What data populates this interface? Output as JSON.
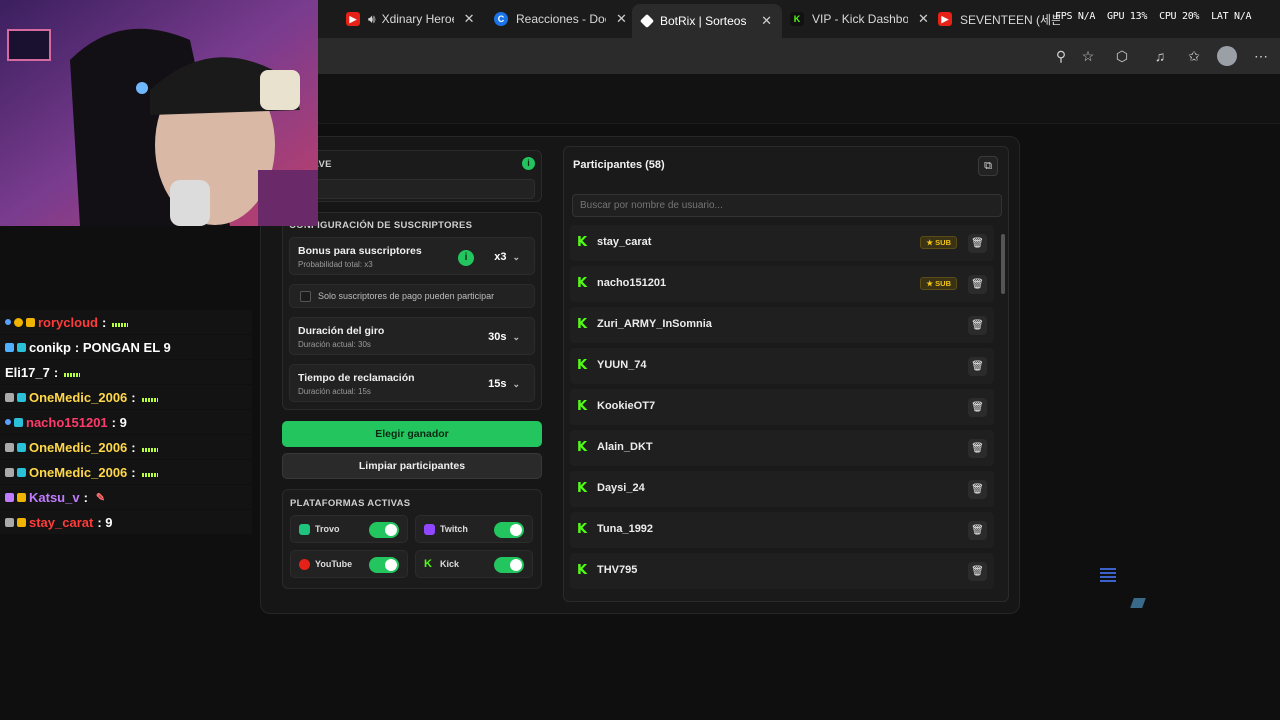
{
  "browser": {
    "tabs": [
      {
        "label": "Xdinary Heroes",
        "icon": "youtube-icon",
        "audio": true
      },
      {
        "label": "Reacciones - Doc",
        "icon": "c-icon"
      },
      {
        "label": "BotRix | Sorteos",
        "icon": "botrix-icon",
        "active": true
      },
      {
        "label": "VIP - Kick Dashboa",
        "icon": "kick-icon"
      },
      {
        "label": "SEVENTEEN (세븐틴)",
        "icon": "youtube-icon"
      }
    ],
    "perf": {
      "fps": "FPS N/A",
      "gpu": "GPU 13%",
      "cpu": "CPU 20%",
      "lat": "LAT N/A"
    }
  },
  "giveaway": {
    "keyword_title": "A CLAVE",
    "sub_config_title": "CONFIGURACIÓN DE SUSCRIPTORES",
    "bonus": {
      "title": "Bonus para suscriptores",
      "subtitle": "Probabilidad total: x3",
      "value": "x3"
    },
    "only_paid": "Solo suscriptores de pago pueden participar",
    "spin": {
      "title": "Duración del giro",
      "subtitle": "Duración actual: 30s",
      "value": "30s"
    },
    "claim": {
      "title": "Tiempo de reclamación",
      "subtitle": "Duración actual: 15s",
      "value": "15s"
    },
    "pick_winner": "Elegir ganador",
    "clear": "Limpiar participantes",
    "platforms_title": "PLATAFORMAS ACTIVAS",
    "platforms": [
      {
        "name": "Trovo",
        "color": "#1ec47e",
        "on": true
      },
      {
        "name": "Twitch",
        "color": "#9146ff",
        "on": true
      },
      {
        "name": "YouTube",
        "color": "#e62117",
        "on": true
      },
      {
        "name": "Kick",
        "color": "#53fc18",
        "on": true
      }
    ]
  },
  "participants": {
    "title": "Participantes (58)",
    "search_placeholder": "Buscar por nombre de usuario...",
    "sub_label": "SUB",
    "items": [
      {
        "name": "stay_carat",
        "sub": true
      },
      {
        "name": "nacho151201",
        "sub": true
      },
      {
        "name": "Zuri_ARMY_InSomnia",
        "sub": false
      },
      {
        "name": "YUUN_74",
        "sub": false
      },
      {
        "name": "KookieOT7",
        "sub": false
      },
      {
        "name": "Alain_DKT",
        "sub": false
      },
      {
        "name": "Daysi_24",
        "sub": false
      },
      {
        "name": "Tuna_1992",
        "sub": false
      },
      {
        "name": "THV795",
        "sub": false
      }
    ]
  },
  "chat": [
    {
      "user": "rorycloud",
      "color": "#ff3b3b",
      "msg": ":",
      "emote": true
    },
    {
      "user": "conikp",
      "color": "#ffffff",
      "msg": ": PONGAN EL 9",
      "emote": false
    },
    {
      "user": "Eli17_7",
      "color": "#ffffff",
      "msg": ":",
      "emote": true
    },
    {
      "user": "OneMedic_2006",
      "color": "#ffd84a",
      "msg": ":",
      "emote": true
    },
    {
      "user": "nacho151201",
      "color": "#ff3b6b",
      "msg": ": 9",
      "emote": false
    },
    {
      "user": "OneMedic_2006",
      "color": "#ffd84a",
      "msg": ":",
      "emote": true
    },
    {
      "user": "OneMedic_2006",
      "color": "#ffd84a",
      "msg": ":",
      "emote": true
    },
    {
      "user": "Katsu_v",
      "color": "#c07cff",
      "msg": ":",
      "emote": false
    },
    {
      "user": "stay_carat",
      "color": "#ff3b3b",
      "msg": ": 9",
      "emote": false
    }
  ]
}
